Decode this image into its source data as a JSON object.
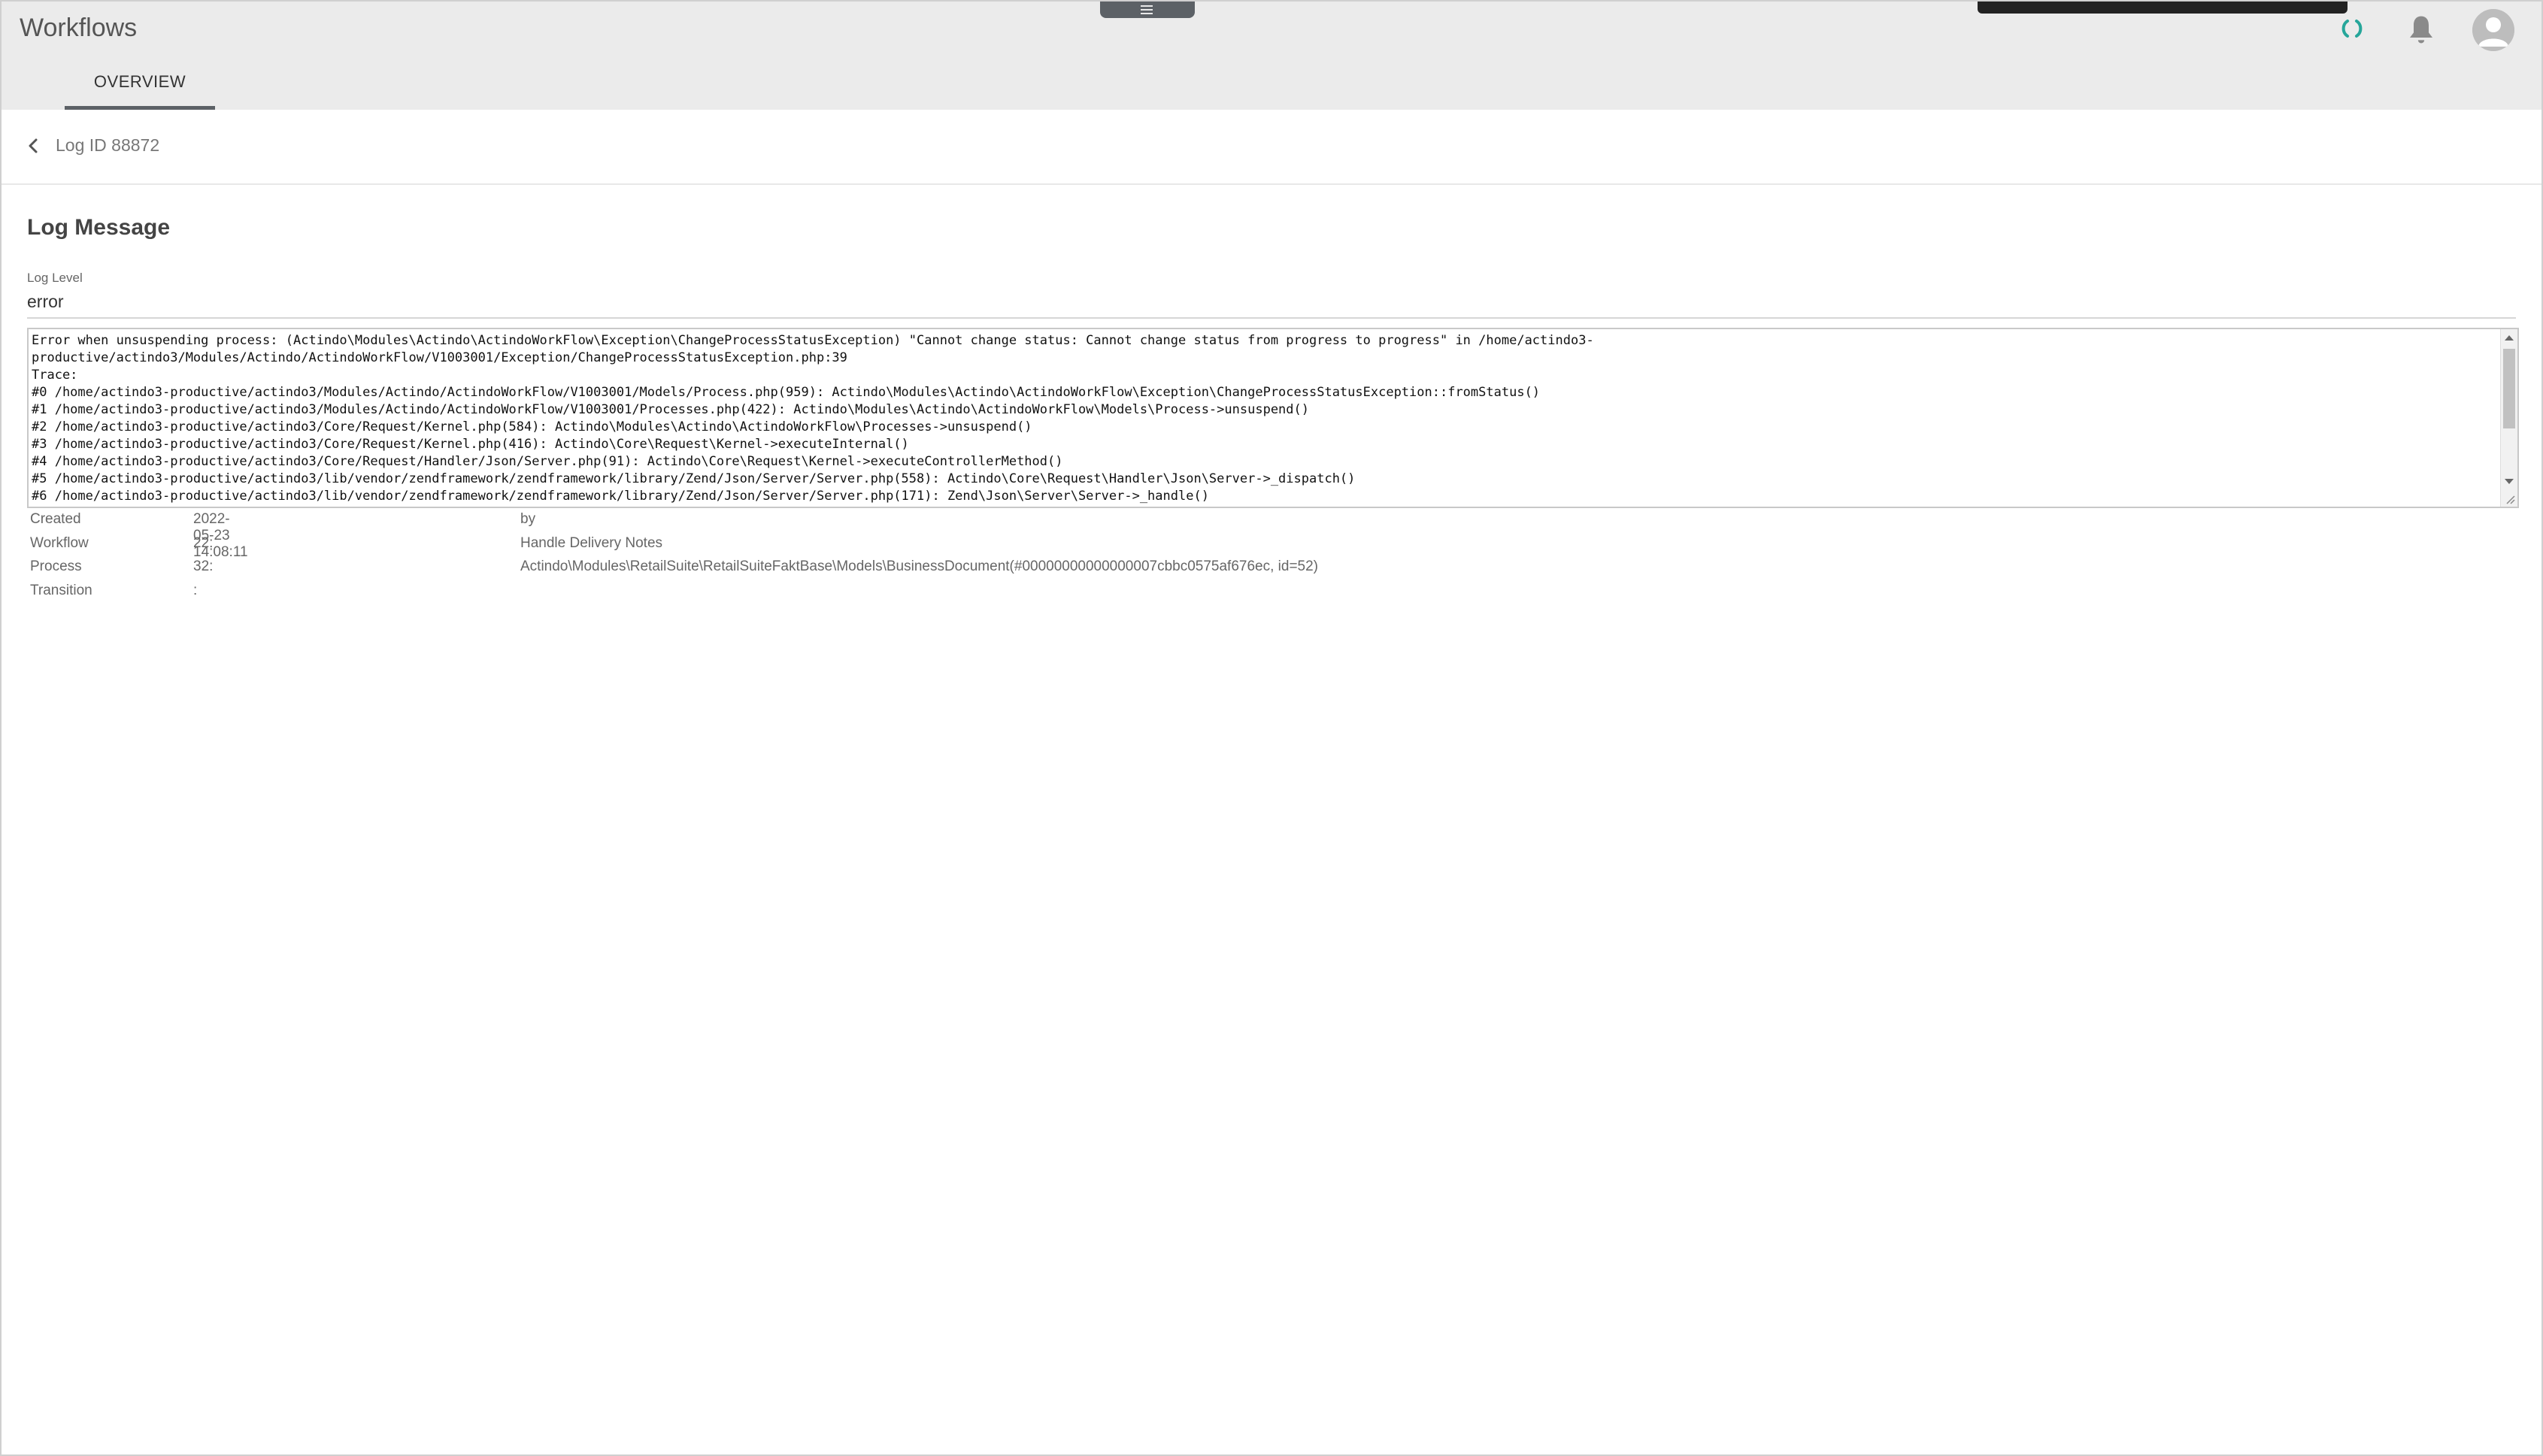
{
  "app": {
    "title": "Workflows"
  },
  "tabs": [
    {
      "label": "OVERVIEW",
      "active": true
    }
  ],
  "breadcrumb": {
    "title": "Log ID 88872"
  },
  "section": {
    "title": "Log Message"
  },
  "log_level": {
    "label": "Log Level",
    "value": "error"
  },
  "log_message": "Error when unsuspending process: (Actindo\\Modules\\Actindo\\ActindoWorkFlow\\Exception\\ChangeProcessStatusException) \"Cannot change status: Cannot change status from progress to progress\" in /home/actindo3-\nproductive/actindo3/Modules/Actindo/ActindoWorkFlow/V1003001/Exception/ChangeProcessStatusException.php:39\nTrace:\n#0 /home/actindo3-productive/actindo3/Modules/Actindo/ActindoWorkFlow/V1003001/Models/Process.php(959): Actindo\\Modules\\Actindo\\ActindoWorkFlow\\Exception\\ChangeProcessStatusException::fromStatus()\n#1 /home/actindo3-productive/actindo3/Modules/Actindo/ActindoWorkFlow/V1003001/Processes.php(422): Actindo\\Modules\\Actindo\\ActindoWorkFlow\\Models\\Process->unsuspend()\n#2 /home/actindo3-productive/actindo3/Core/Request/Kernel.php(584): Actindo\\Modules\\Actindo\\ActindoWorkFlow\\Processes->unsuspend()\n#3 /home/actindo3-productive/actindo3/Core/Request/Kernel.php(416): Actindo\\Core\\Request\\Kernel->executeInternal()\n#4 /home/actindo3-productive/actindo3/Core/Request/Handler/Json/Server.php(91): Actindo\\Core\\Request\\Kernel->executeControllerMethod()\n#5 /home/actindo3-productive/actindo3/lib/vendor/zendframework/zendframework/library/Zend/Json/Server/Server.php(558): Actindo\\Core\\Request\\Handler\\Json\\Server->_dispatch()\n#6 /home/actindo3-productive/actindo3/lib/vendor/zendframework/zendframework/library/Zend/Json/Server/Server.php(171): Zend\\Json\\Server\\Server->_handle()",
  "details": {
    "created": {
      "label": "Created",
      "value": "2022-05-23 14:08:11",
      "extra": "by"
    },
    "workflow": {
      "label": "Workflow",
      "value": "22:",
      "extra": "Handle Delivery Notes"
    },
    "process": {
      "label": "Process",
      "value": "32:",
      "extra": "Actindo\\Modules\\RetailSuite\\RetailSuiteFaktBase\\Models\\BusinessDocument(#00000000000000007cbbc0575af676ec, id=52)"
    },
    "transition": {
      "label": "Transition",
      "value": ":",
      "extra": ""
    }
  },
  "icons": {
    "menu": "hamburger-icon",
    "spinner": "loading-spinner-icon",
    "notifications": "bell-icon",
    "account": "user-avatar-icon",
    "back": "chevron-left-icon"
  },
  "colors": {
    "header_bg": "#ebebeb",
    "tab_underline": "#5c6166",
    "spinner": "#26a69a",
    "bell": "#8a8a8a"
  }
}
